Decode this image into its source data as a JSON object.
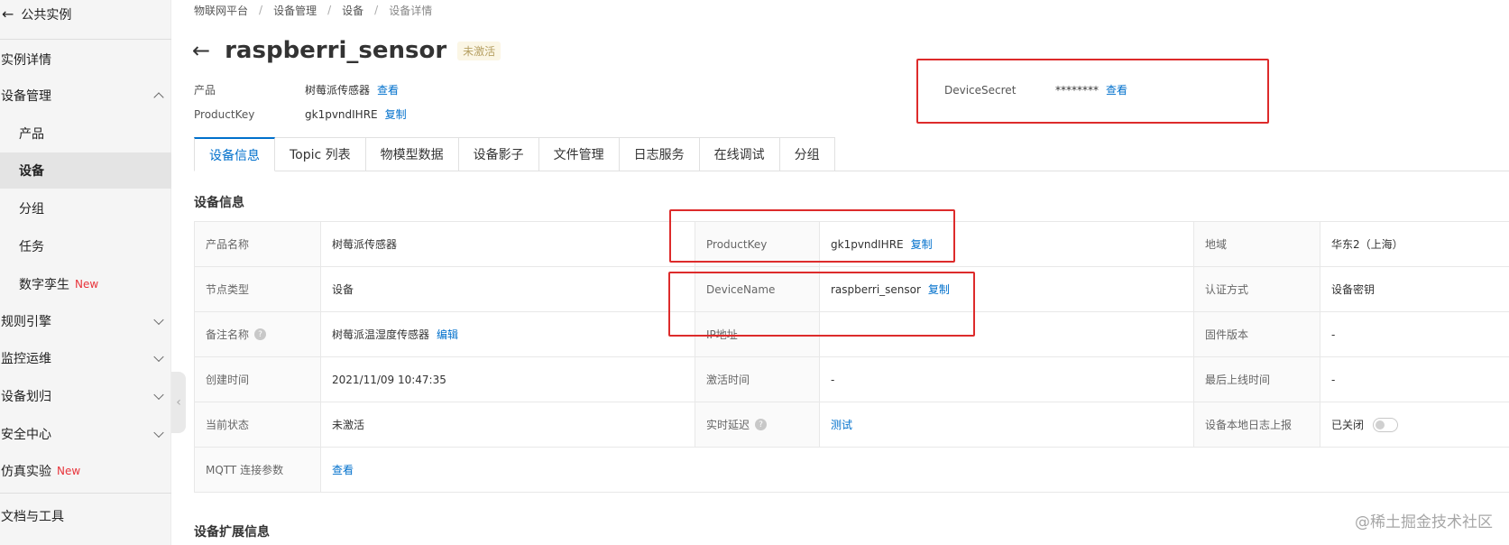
{
  "sidebar": {
    "back_label": "公共实例",
    "items": [
      {
        "label": "实例详情"
      },
      {
        "label": "设备管理"
      },
      {
        "label": "产品"
      },
      {
        "label": "设备"
      },
      {
        "label": "分组"
      },
      {
        "label": "任务"
      },
      {
        "label": "数字孪生",
        "badge": "New"
      },
      {
        "label": "规则引擎"
      },
      {
        "label": "监控运维"
      },
      {
        "label": "设备划归"
      },
      {
        "label": "安全中心"
      },
      {
        "label": "仿真实验",
        "badge": "New"
      },
      {
        "label": "文档与工具"
      }
    ]
  },
  "breadcrumb": [
    "物联网平台",
    "设备管理",
    "设备",
    "设备详情"
  ],
  "header": {
    "title": "raspberri_sensor",
    "status": "未激活"
  },
  "meta": {
    "product_label": "产品",
    "product_value": "树莓派传感器",
    "product_link": "查看",
    "productkey_label": "ProductKey",
    "productkey_value": "gk1pvndIHRE",
    "productkey_link": "复制",
    "devicesecret_label": "DeviceSecret",
    "devicesecret_value": "********",
    "devicesecret_link": "查看"
  },
  "tabs": [
    "设备信息",
    "Topic 列表",
    "物模型数据",
    "设备影子",
    "文件管理",
    "日志服务",
    "在线调试",
    "分组"
  ],
  "device_info": {
    "section_title": "设备信息",
    "rows": [
      {
        "l1": "产品名称",
        "v1": "树莓派传感器",
        "l2": "ProductKey",
        "v2": "gk1pvndIHRE",
        "v2_link": "复制",
        "l3": "地域",
        "v3": "华东2（上海）"
      },
      {
        "l1": "节点类型",
        "v1": "设备",
        "l2": "DeviceName",
        "v2": "raspberri_sensor",
        "v2_link": "复制",
        "l3": "认证方式",
        "v3": "设备密钥"
      },
      {
        "l1": "备注名称",
        "v1": "树莓派温湿度传感器",
        "v1_link": "编辑",
        "l2": "IP地址",
        "v2": "",
        "l3": "固件版本",
        "v3": "-"
      },
      {
        "l1": "创建时间",
        "v1": "2021/11/09 10:47:35",
        "l2": "激活时间",
        "v2": "-",
        "l3": "最后上线时间",
        "v3": "-"
      },
      {
        "l1": "当前状态",
        "v1": "未激活",
        "l2": "实时延迟",
        "v2_link": "测试",
        "l3": "设备本地日志上报",
        "v3": "已关闭"
      },
      {
        "l1": "MQTT 连接参数",
        "v1_link": "查看"
      }
    ]
  },
  "ext_section_title": "设备扩展信息",
  "watermark": "@稀土掘金技术社区",
  "colors": {
    "link": "#0070cc",
    "highlight_box": "#dd2b2b",
    "new_badge": "#e8343b"
  }
}
